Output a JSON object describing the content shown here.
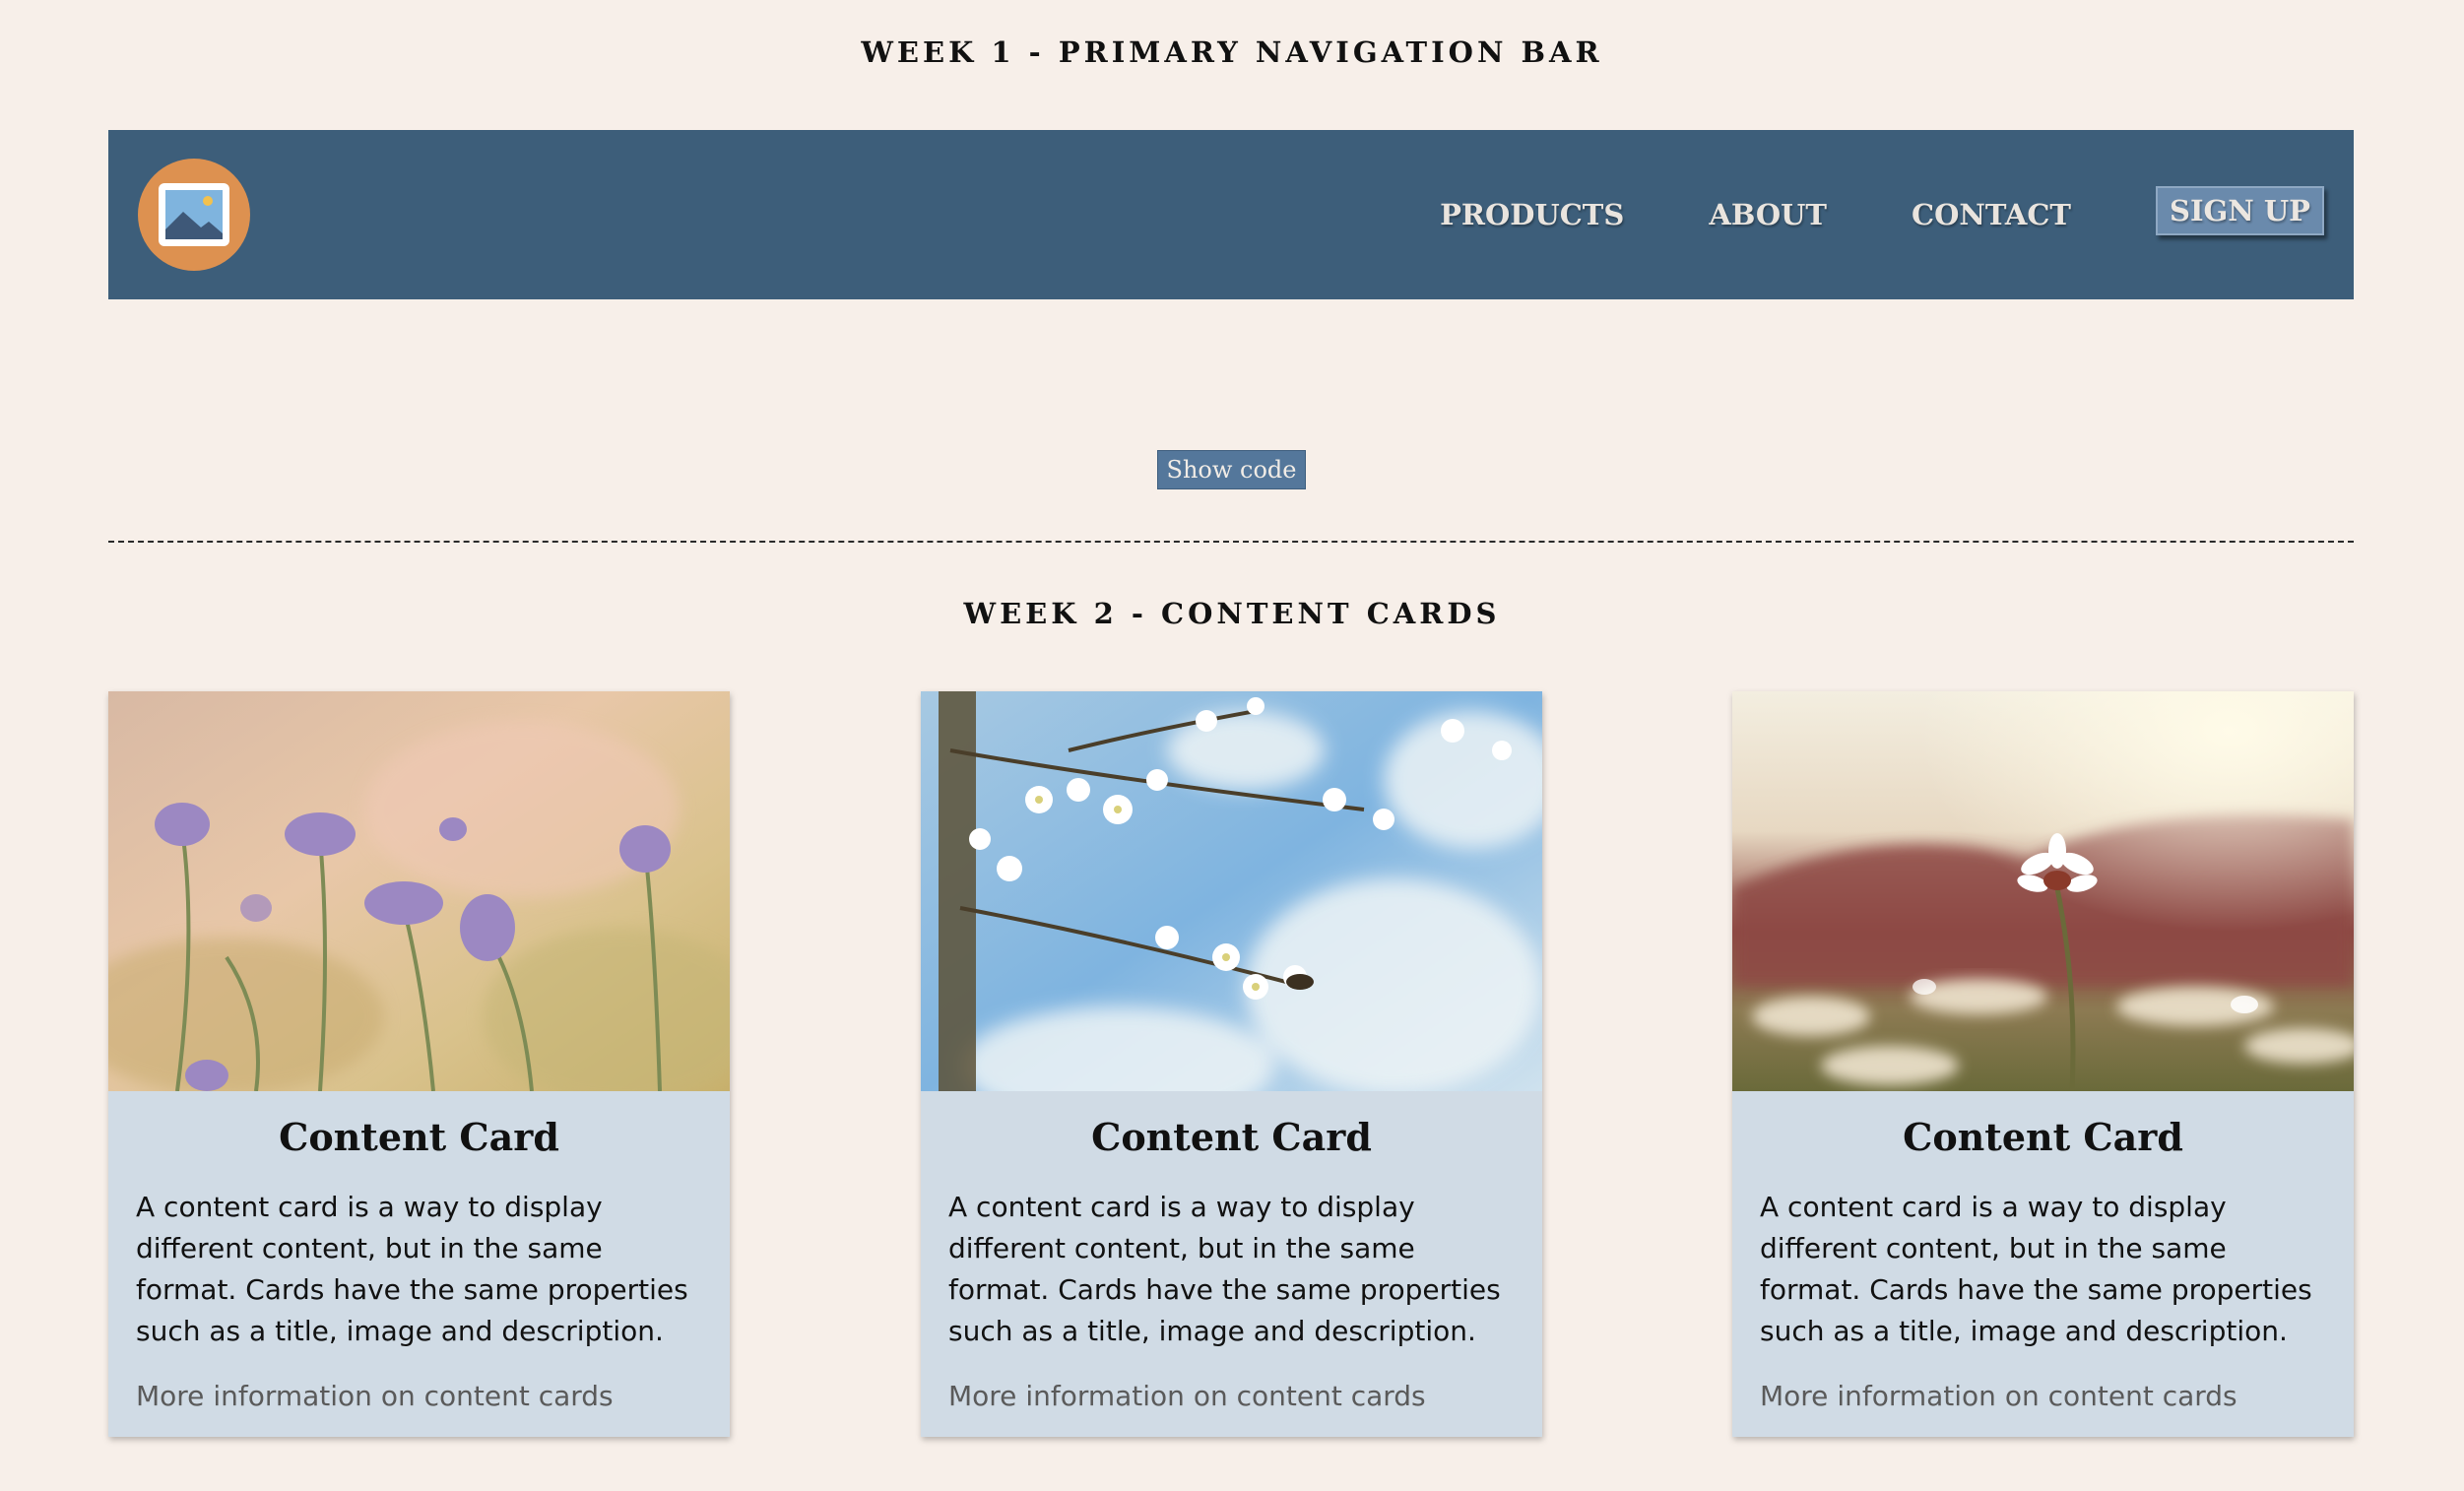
{
  "week1": {
    "title": "WEEK 1 - PRIMARY NAVIGATION BAR"
  },
  "navbar": {
    "logo_icon": "image-icon",
    "links": [
      "PRODUCTS",
      "ABOUT",
      "CONTACT"
    ],
    "signup_label": "SIGN UP"
  },
  "show_code_label": "Show code",
  "week2": {
    "title": "WEEK 2 - CONTENT CARDS"
  },
  "cards": [
    {
      "image": "purple-wildflowers-photo",
      "title": "Content Card",
      "text": "A content card is a way to display different content, but in the same format. Cards have the same properties such as a title, image and description.",
      "link": "More information on content cards"
    },
    {
      "image": "white-blossom-branch-photo",
      "title": "Content Card",
      "text": "A content card is a way to display different content, but in the same format. Cards have the same properties such as a title, image and description.",
      "link": "More information on content cards"
    },
    {
      "image": "daisy-field-sunset-photo",
      "title": "Content Card",
      "text": "A content card is a way to display different content, but in the same format. Cards have the same properties such as a title, image and description.",
      "link": "More information on content cards"
    }
  ],
  "colors": {
    "page_bg": "#f7efe9",
    "navbar_bg": "#3d5e7a",
    "logo_bg": "#dd9150",
    "signup_bg": "#6a8aac",
    "card_bg": "#d0dbe5",
    "button_bg": "#54779b"
  }
}
